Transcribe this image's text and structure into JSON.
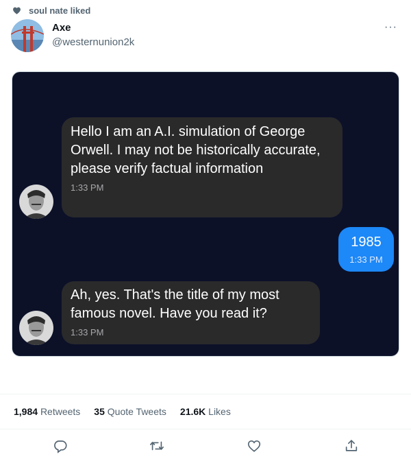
{
  "social_context": {
    "text": "soul nate liked"
  },
  "author": {
    "name": "Axe",
    "handle": "@westernunion2k",
    "more": "···"
  },
  "chat": {
    "messages": [
      {
        "side": "incoming",
        "text": "Hello I am an A.I. simulation of George Orwell. I may not be historically accurate, please verify factual information",
        "time": "1:33 PM"
      },
      {
        "side": "outgoing",
        "text": "1985",
        "time": "1:33 PM"
      },
      {
        "side": "incoming",
        "text": "Ah, yes. That's the title of my most famous novel. Have you read it?",
        "time": "1:33 PM"
      }
    ]
  },
  "stats": {
    "retweets": {
      "count": "1,984",
      "label": "Retweets"
    },
    "quotes": {
      "count": "35",
      "label": "Quote Tweets"
    },
    "likes": {
      "count": "21.6K",
      "label": "Likes"
    }
  },
  "actions": [
    "reply-icon",
    "retweet-icon",
    "like-icon",
    "share-icon"
  ],
  "colors": {
    "accent": "#1d9bf0",
    "chat_bg": "#0c1128",
    "incoming_bubble": "#2a2a2b",
    "outgoing_bubble": "#1d88f7"
  }
}
